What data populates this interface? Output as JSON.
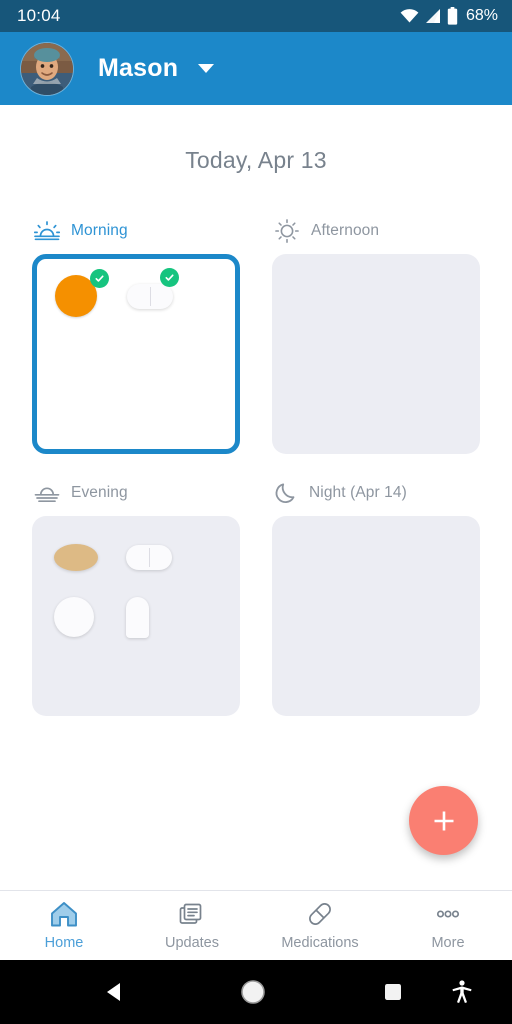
{
  "status_bar": {
    "time": "10:04",
    "battery_percent": "68%",
    "wifi_icon": "wifi-icon",
    "signal_icon": "cellular-signal-icon",
    "battery_icon": "battery-icon",
    "background_color": "#17567a"
  },
  "app_bar": {
    "profile_name": "Mason",
    "avatar_icon": "user-avatar-photo",
    "dropdown_icon": "chevron-down-icon",
    "background_color": "#1c88c9"
  },
  "page_title": "Today, Apr 13",
  "schedule": {
    "slots": [
      {
        "id": "morning",
        "label": "Morning",
        "icon": "sunrise-icon",
        "active": true,
        "pills": [
          {
            "name": "round-tablet",
            "shape": "round",
            "color": "#f59000",
            "taken": true
          },
          {
            "name": "capsule",
            "shape": "capsule",
            "color": "#fbfbfd",
            "taken": true
          }
        ]
      },
      {
        "id": "afternoon",
        "label": "Afternoon",
        "icon": "sun-icon",
        "active": false,
        "pills": []
      },
      {
        "id": "evening",
        "label": "Evening",
        "icon": "sunset-icon",
        "active": false,
        "pills": [
          {
            "name": "oval-tablet",
            "shape": "oval",
            "color": "#ddba85",
            "taken": false
          },
          {
            "name": "capsule",
            "shape": "capsule",
            "color": "#fbfbfd",
            "taken": false
          },
          {
            "name": "round-tablet",
            "shape": "white-round",
            "color": "#fbfbfd",
            "taken": false
          },
          {
            "name": "oblong-tablet",
            "shape": "dome",
            "color": "#fbfbfd",
            "taken": false
          }
        ]
      },
      {
        "id": "night",
        "label": "Night (Apr 14)",
        "icon": "moon-icon",
        "active": false,
        "pills": []
      }
    ]
  },
  "fab": {
    "label": "+",
    "icon": "plus-icon",
    "color": "#fa7f72"
  },
  "tab_bar": {
    "active_color": "#4c9fd8",
    "inactive_color": "#8e96a0",
    "tabs": [
      {
        "id": "home",
        "label": "Home",
        "icon": "home-icon",
        "active": true
      },
      {
        "id": "updates",
        "label": "Updates",
        "icon": "news-documents-icon",
        "active": false
      },
      {
        "id": "medications",
        "label": "Medications",
        "icon": "capsule-icon",
        "active": false
      },
      {
        "id": "more",
        "label": "More",
        "icon": "ellipsis-icon",
        "active": false
      }
    ]
  },
  "android_nav": {
    "back_icon": "back-triangle-icon",
    "home_icon": "home-circle-icon",
    "recents_icon": "recents-square-icon",
    "accessibility_icon": "accessibility-icon"
  }
}
